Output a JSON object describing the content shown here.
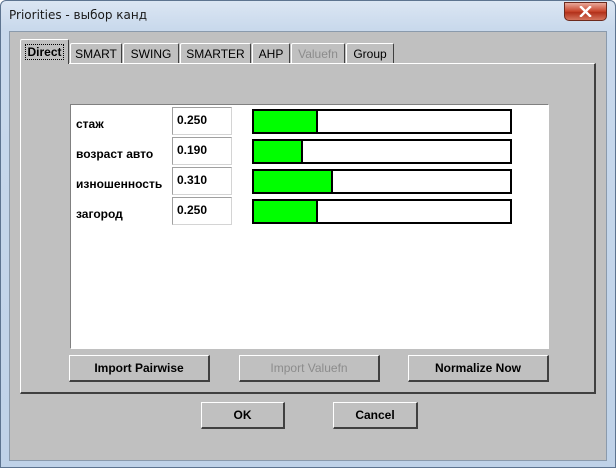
{
  "window": {
    "title": "Priorities - выбор канд"
  },
  "tabs": [
    {
      "label": "Direct",
      "active": true,
      "enabled": true
    },
    {
      "label": "SMART",
      "active": false,
      "enabled": true
    },
    {
      "label": "SWING",
      "active": false,
      "enabled": true
    },
    {
      "label": "SMARTER",
      "active": false,
      "enabled": true
    },
    {
      "label": "AHP",
      "active": false,
      "enabled": true
    },
    {
      "label": "Valuefn",
      "active": false,
      "enabled": false
    },
    {
      "label": "Group",
      "active": false,
      "enabled": true
    }
  ],
  "criteria": [
    {
      "label": "стаж",
      "value": "0.250",
      "weight": 0.25
    },
    {
      "label": "возраст авто",
      "value": "0.190",
      "weight": 0.19
    },
    {
      "label": "изношенность",
      "value": "0.310",
      "weight": 0.31
    },
    {
      "label": "загород",
      "value": "0.250",
      "weight": 0.25
    }
  ],
  "panel_buttons": {
    "import_pairwise": "Import Pairwise",
    "import_valuefn": "Import Valuefn",
    "normalize_now": "Normalize Now"
  },
  "dialog_buttons": {
    "ok": "OK",
    "cancel": "Cancel"
  },
  "colors": {
    "bar_fill": "#00ff00",
    "face": "#c0c0c0",
    "close_button": "#c7432a"
  }
}
